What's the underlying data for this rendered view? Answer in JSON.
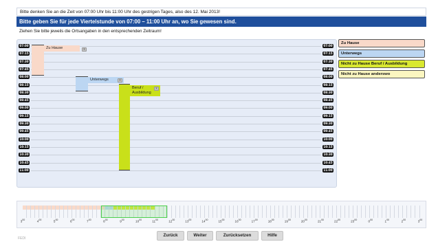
{
  "header": {
    "hint": "Bitte denken Sie an die Zeit von 07:00 Uhr bis 11:00 Uhr des gestrigen Tages, also des 12. Mai 2013!",
    "title": "Bitte geben Sie für jede Viertelstunde von 07:00 – 11:00 Uhr an, wo Sie gewesen sind.",
    "subhint": "Ziehen Sie bitte jeweils die Ortsangaben in den entsprechenden Zeitraum!"
  },
  "timeline": {
    "labels": [
      "07:00",
      "07:15",
      "07:30",
      "07:45",
      "08:00",
      "08:15",
      "08:30",
      "08:45",
      "09:00",
      "09:15",
      "09:30",
      "09:45",
      "10:00",
      "10:15",
      "10:30",
      "10:45",
      "11:00"
    ],
    "blocks": [
      {
        "label": "Zu Hause",
        "close_icon": "x",
        "color": "#f9d9c9"
      },
      {
        "label": "Unterwegs",
        "close_icon": "x",
        "color": "#bcd6f2"
      },
      {
        "label": "Beruf / Ausbildung",
        "close_icon": "x",
        "color": "#c9e01a"
      }
    ]
  },
  "legend": {
    "items": [
      {
        "label": "Zu Hause",
        "color": "#f9d9c9"
      },
      {
        "label": "Unterwegs",
        "color": "#bcd6f2"
      },
      {
        "label": "Nicht zu Hause Beruf / Ausbildung",
        "color": "#d9e830"
      },
      {
        "label": "Nicht zu Hause anderswo",
        "color": "#fbf6c0"
      }
    ]
  },
  "overview": {
    "hours": [
      "3",
      "4",
      "5",
      "6",
      "7",
      "8",
      "9",
      "10",
      "11",
      "12",
      "13",
      "14",
      "15",
      "16",
      "17",
      "18",
      "19",
      "20",
      "21",
      "22",
      "23",
      "0",
      "1",
      "2",
      "3"
    ],
    "hour_suffix": "00"
  },
  "buttons": {
    "back": "Zurück",
    "next": "Weiter",
    "reset": "Zurücksetzen",
    "help": "Hilfe"
  },
  "footer": {
    "version": "FEDI"
  }
}
